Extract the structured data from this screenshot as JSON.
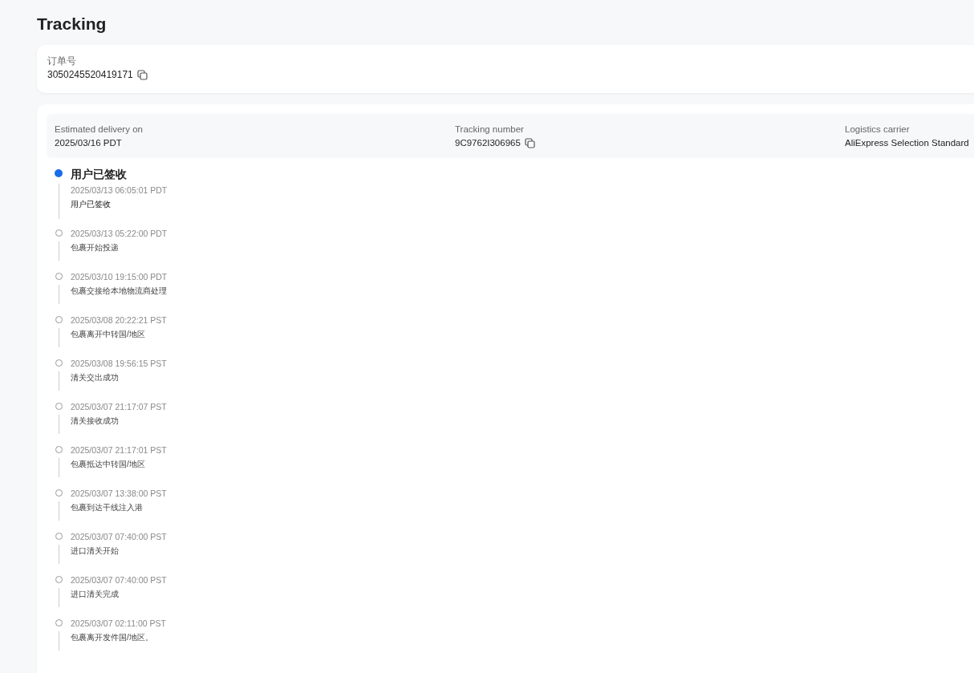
{
  "page": {
    "title": "Tracking"
  },
  "order": {
    "label": "订单号",
    "number": "3050245520419171"
  },
  "summary": [
    {
      "kind": "text",
      "label": "Estimated delivery on",
      "value": "2025/03/16 PDT"
    },
    {
      "kind": "copy",
      "label": "Tracking number",
      "value": "9C9762I306965"
    },
    {
      "kind": "text",
      "label": "Logistics carrier",
      "value": "AliExpress Selection Standard"
    }
  ],
  "events": [
    {
      "active": true,
      "title": "用户已签收",
      "time": "2025/03/13 06:05:01 PDT",
      "description": "用户已签收"
    },
    {
      "active": false,
      "time": "2025/03/13 05:22:00 PDT",
      "description": "包裹开始投递"
    },
    {
      "active": false,
      "time": "2025/03/10 19:15:00 PDT",
      "description": "包裹交接给本地物流商处理"
    },
    {
      "active": false,
      "time": "2025/03/08 20:22:21 PST",
      "description": "包裹离开中转国/地区"
    },
    {
      "active": false,
      "time": "2025/03/08 19:56:15 PST",
      "description": "清关交出成功"
    },
    {
      "active": false,
      "time": "2025/03/07 21:17:07 PST",
      "description": "清关接收成功"
    },
    {
      "active": false,
      "time": "2025/03/07 21:17:01 PST",
      "description": "包裹抵达中转国/地区"
    },
    {
      "active": false,
      "time": "2025/03/07 13:38:00 PST",
      "description": "包裹到达干线注入港"
    },
    {
      "active": false,
      "time": "2025/03/07 07:40:00 PST",
      "description": "进口清关开始"
    },
    {
      "active": false,
      "time": "2025/03/07 07:40:00 PST",
      "description": "进口清关完成"
    },
    {
      "active": false,
      "time": "2025/03/07 02:11:00 PST",
      "description": "包裹离开发件国/地区。"
    }
  ]
}
